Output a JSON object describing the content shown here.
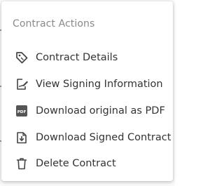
{
  "menu": {
    "title": "Contract Actions",
    "items": [
      {
        "label": "Contract Details",
        "icon": "tag-icon"
      },
      {
        "label": "View Signing Information",
        "icon": "signature-icon"
      },
      {
        "label": "Download original as PDF",
        "icon": "pdf-icon"
      },
      {
        "label": "Download Signed Contract",
        "icon": "download-file-icon"
      },
      {
        "label": "Delete Contract",
        "icon": "trash-icon"
      }
    ]
  },
  "colors": {
    "icon": "#444444",
    "label": "#333333",
    "title": "#8a8a8a"
  }
}
